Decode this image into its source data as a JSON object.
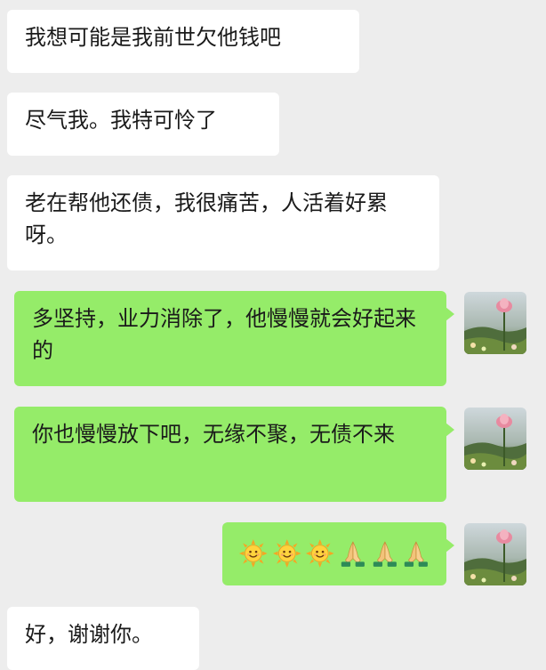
{
  "messages": [
    {
      "side": "incoming",
      "text": "我想可能是我前世欠他钱吧"
    },
    {
      "side": "incoming",
      "text": "尽气我。我特可怜了"
    },
    {
      "side": "incoming",
      "text": "老在帮他还债，我很痛苦，人活着好累呀。"
    },
    {
      "side": "outgoing",
      "text": "多坚持，业力消除了，他慢慢就会好起来的"
    },
    {
      "side": "outgoing",
      "text": "你也慢慢放下吧，无缘不聚，无债不来"
    },
    {
      "side": "outgoing",
      "emojis": [
        "sun-emoji",
        "sun-emoji",
        "sun-emoji",
        "pray-emoji",
        "pray-emoji",
        "pray-emoji"
      ]
    },
    {
      "side": "incoming",
      "text": "好，谢谢你。"
    }
  ],
  "colors": {
    "background": "#ededed",
    "incoming_bubble": "#ffffff",
    "outgoing_bubble": "#95ec69",
    "text": "#1a1a1a"
  },
  "avatar": {
    "icon": "lotus-avatar"
  }
}
